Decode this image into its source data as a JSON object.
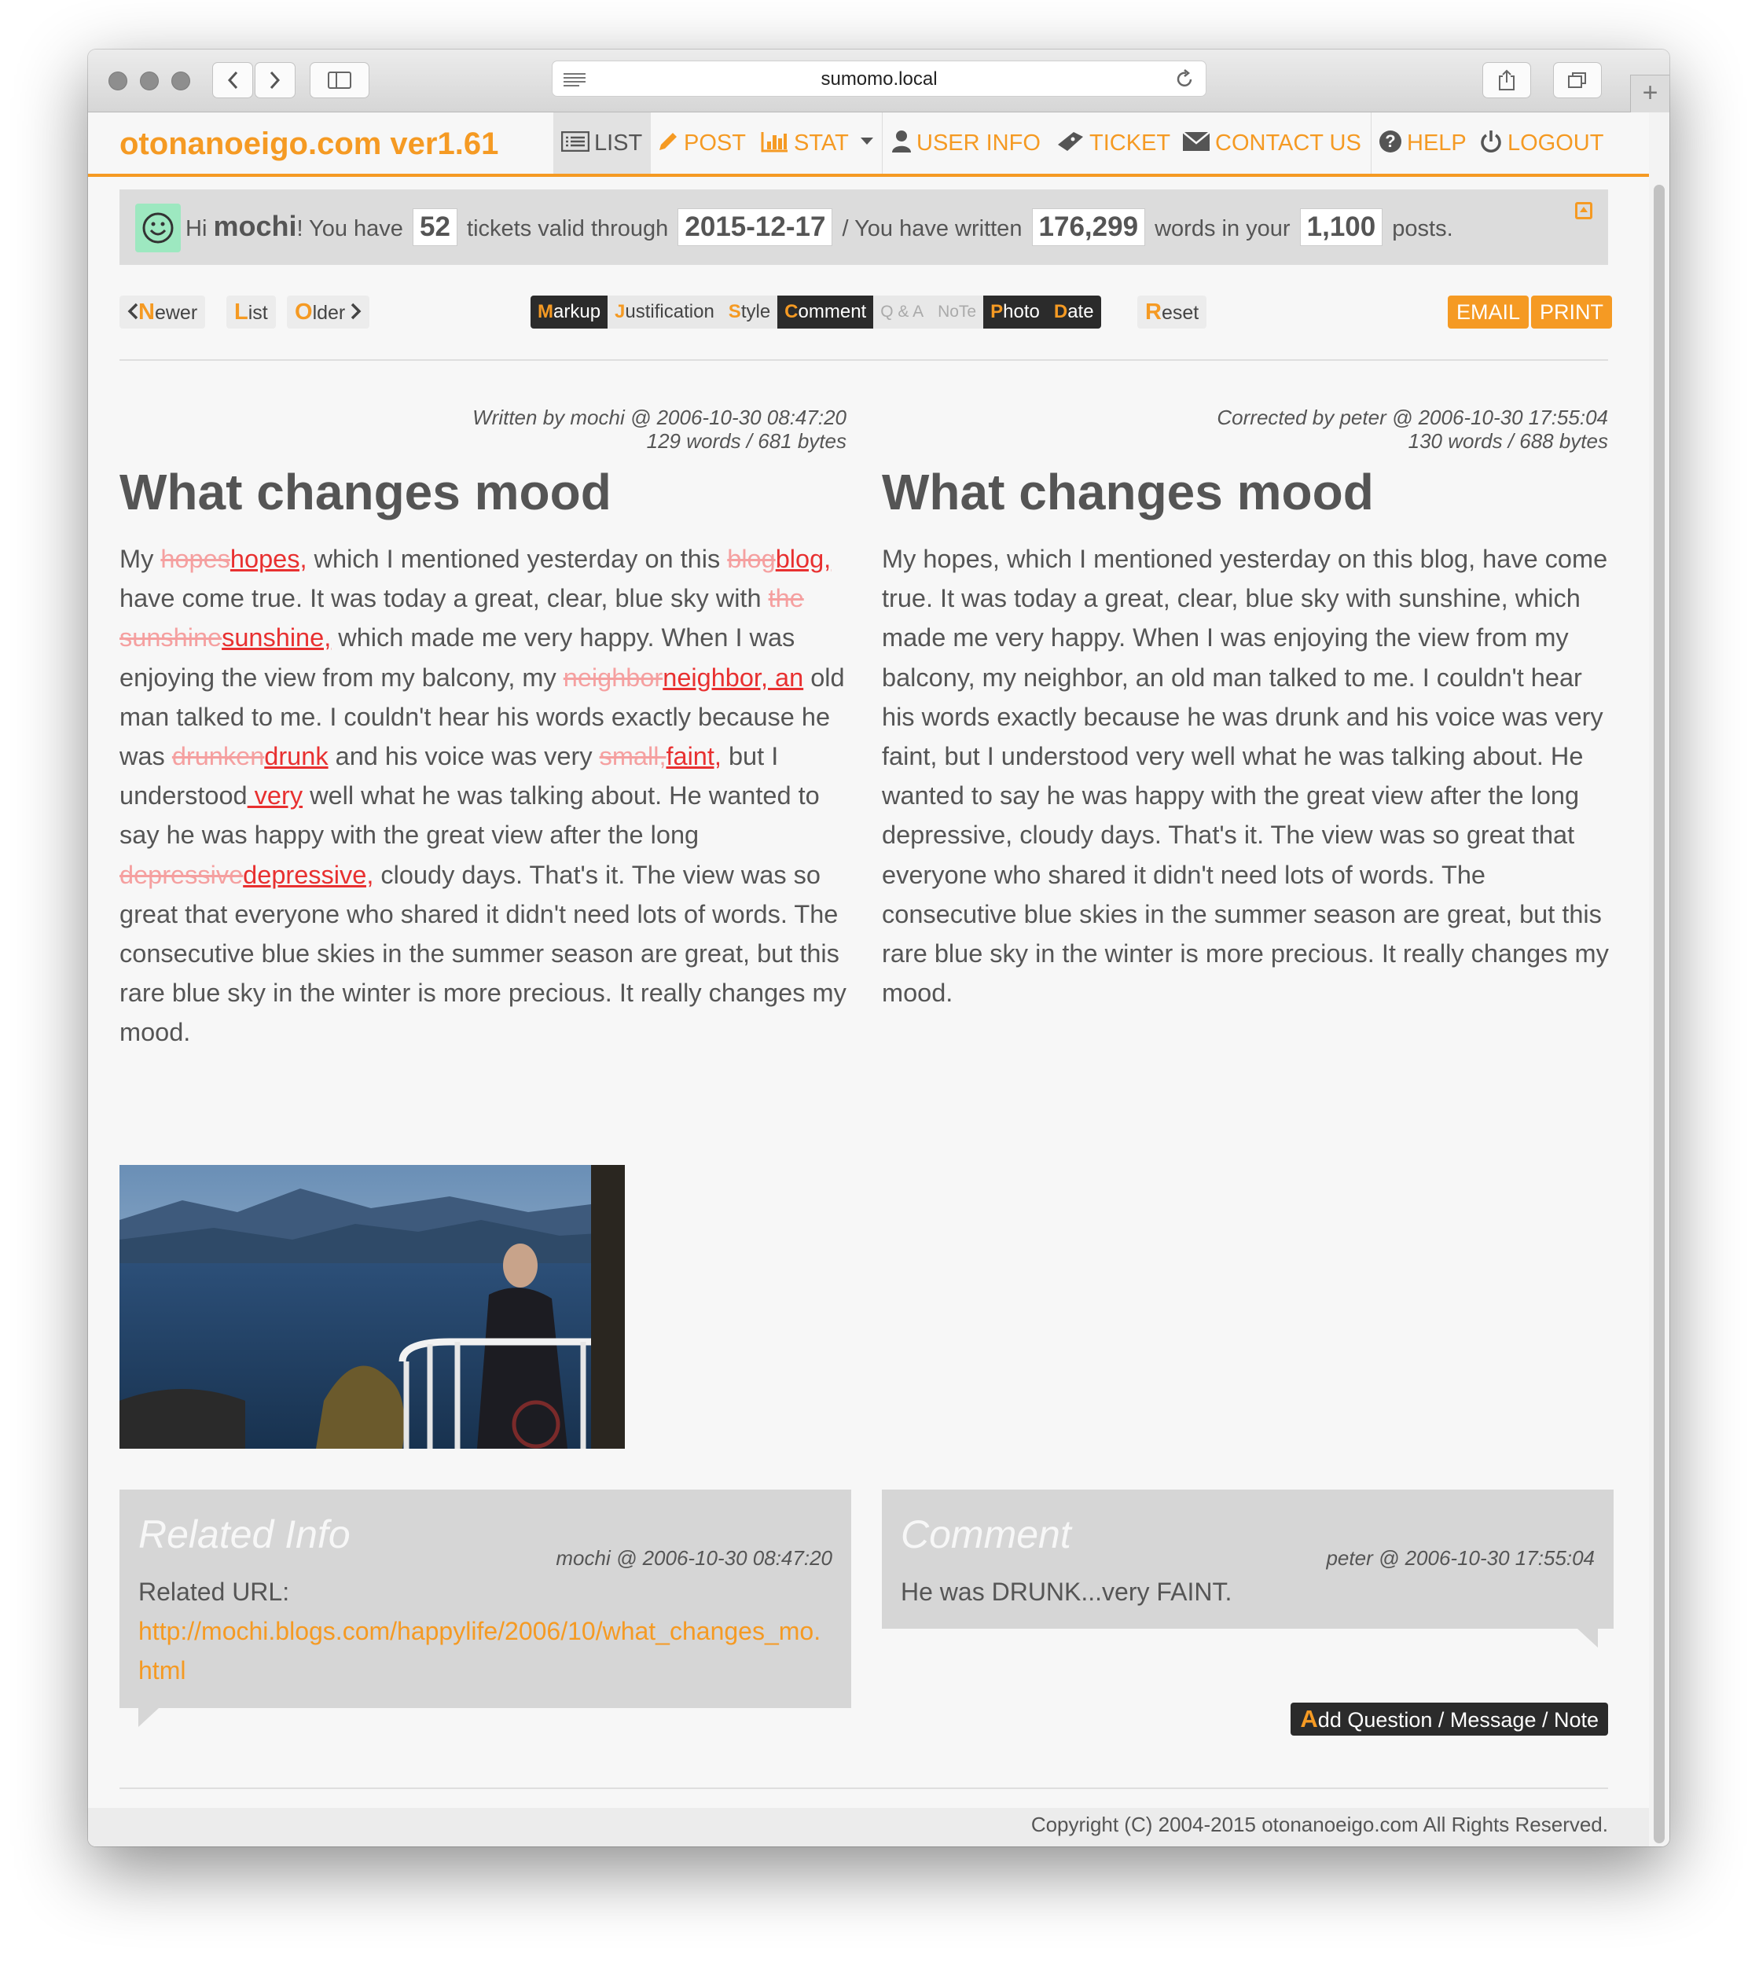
{
  "browser": {
    "url": "sumomo.local"
  },
  "nav": {
    "brand": "otonanoeigo.com ver1.61",
    "list": "LIST",
    "post": "POST",
    "stat": "STAT",
    "user_info": "USER INFO",
    "ticket": "TICKET",
    "contact_us": "CONTACT US",
    "help": "HELP",
    "logout": "LOGOUT",
    "accent_color": "#f59a23"
  },
  "info": {
    "hi": "Hi",
    "name": "mochi",
    "t1": "! You have",
    "tickets": "52",
    "t2": "tickets valid through",
    "valid_through": "2015-12-17",
    "t3": "/ You have written",
    "words": "176,299",
    "t4": "words in your",
    "posts": "1,100",
    "t5": "posts."
  },
  "toolbar": {
    "newer_k": "N",
    "newer_r": "ewer",
    "list_k": "L",
    "list_r": "ist",
    "older_k": "O",
    "older_r": "lder",
    "markup_k": "M",
    "markup_r": "arkup",
    "justification_k": "J",
    "justification_r": "ustification",
    "style_k": "S",
    "style_r": "tyle",
    "comment_k": "C",
    "comment_r": "omment",
    "qa": "Q & A",
    "note": "NoTe",
    "photo_k": "P",
    "photo_r": "hoto",
    "date_k": "D",
    "date_r": "ate",
    "reset_k": "R",
    "reset_r": "eset",
    "email": "EMAIL",
    "print": "PRINT"
  },
  "original": {
    "meta1": "Written by mochi @ 2006-10-30 08:47:20",
    "meta2": "129 words / 681 bytes",
    "title": "What changes mood"
  },
  "corrected": {
    "meta1": "Corrected by peter @ 2006-10-30 17:55:04",
    "meta2": "130 words / 688 bytes",
    "title": "What changes mood",
    "body": "My hopes, which I mentioned yesterday on this blog, have come true. It was today a great, clear, blue sky with sunshine, which made me very happy. When I was enjoying the view from my balcony, my neighbor, an old man talked to me. I couldn't hear his words exactly because he was drunk and his voice was very faint, but I understood very well what he was talking about. He wanted to say he was happy with the great view after the long depressive, cloudy days. That's it. The view was so great that everyone who shared it didn't need lots of words. The consecutive blue skies in the summer season are great, but this rare blue sky in the winter is more precious. It really changes my mood."
  },
  "diff": {
    "p1": "My ",
    "d1": "hopes",
    "i1": "hopes,",
    "p2": " which I mentioned yesterday on this ",
    "d2": "blog",
    "i2": "blog,",
    "p3": " have come true. It was today a great, clear, blue sky with ",
    "d3": "the sunshine",
    "i3": "sunshine,",
    "p4": " which made me very happy. When I was enjoying the view from my balcony, my ",
    "d4": "neighbor",
    "i4": "neighbor, an",
    "p5": " old man talked to me. I couldn't hear his words exactly because he was ",
    "d5": "drunken",
    "i5": "drunk",
    "p6": " and his voice was very ",
    "d6": "small,",
    "i6": "faint,",
    "p7": " but I understood",
    "i7": " very",
    "p8": " well what he was talking about. He wanted to say he was happy with the great view after the long ",
    "d8": "depressive",
    "i8": "depressive,",
    "p9": " cloudy days. That's it. The view was so great that everyone who shared it didn't need lots of words. The consecutive blue skies in the summer season are great, but this rare blue sky in the winter is more precious. It really changes my mood."
  },
  "related": {
    "title": "Related Info",
    "who": "mochi @ 2006-10-30 08:47:20",
    "label": "Related URL:",
    "url": "http://mochi.blogs.com/happylife/2006/10/what_changes_mo.html"
  },
  "comment": {
    "title": "Comment",
    "who": "peter @ 2006-10-30 17:55:04",
    "text": "He was DRUNK...very FAINT."
  },
  "add_button": {
    "k": "A",
    "r": "dd Question / Message / Note"
  },
  "footer": {
    "copyright": "Copyright (C) 2004-2015 otonanoeigo.com All Rights Reserved."
  }
}
